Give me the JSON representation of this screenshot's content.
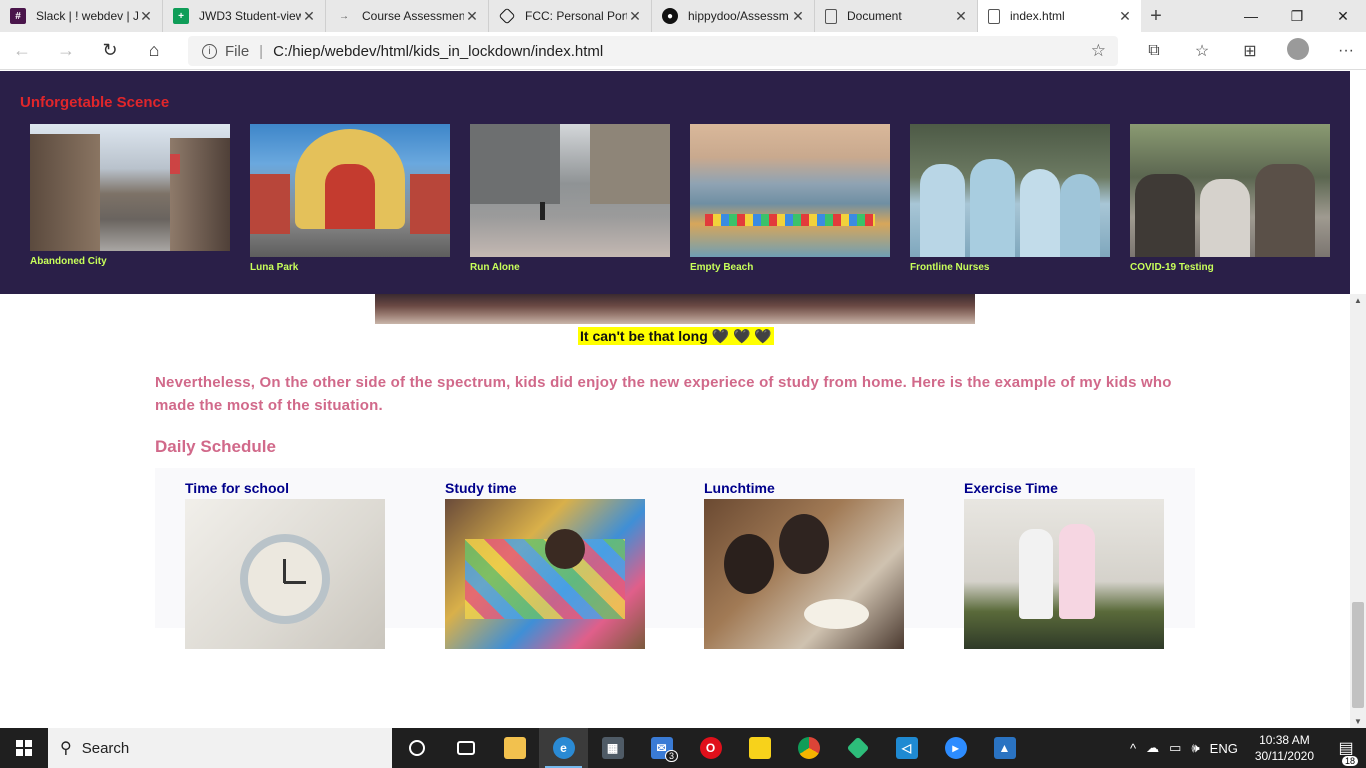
{
  "browser": {
    "tabs": [
      {
        "title": "Slack | ! webdev | J",
        "icon": "slack-icon",
        "color": "#4a154b"
      },
      {
        "title": "JWD3 Student-view",
        "icon": "sheets-icon",
        "color": "#0f9d58"
      },
      {
        "title": "Course Assessmen",
        "icon": "arrow-icon",
        "color": "#555555"
      },
      {
        "title": "FCC: Personal Port",
        "icon": "codepen-icon",
        "color": "#111111"
      },
      {
        "title": "hippydoo/Assessm",
        "icon": "github-icon",
        "color": "#111111"
      },
      {
        "title": "Document",
        "icon": "document-icon",
        "color": "#777777"
      },
      {
        "title": "index.html",
        "icon": "document-icon",
        "color": "#777777"
      }
    ],
    "address": {
      "file_label": "File",
      "url": "C:/hiep/webdev/html/kids_in_lockdown/index.html"
    }
  },
  "gallery": {
    "title": "Unforgetable Scence",
    "items": [
      {
        "caption": "Abandoned City"
      },
      {
        "caption": "Luna Park"
      },
      {
        "caption": "Run Alone"
      },
      {
        "caption": "Empty Beach"
      },
      {
        "caption": "Frontline Nurses"
      },
      {
        "caption": "COVID-19 Testing"
      }
    ]
  },
  "hero": {
    "caption": "It can't be that long 🖤 🖤 🖤"
  },
  "content": {
    "paragraph": "Nevertheless, On the other side of the spectrum, kids did enjoy the new experiece of study from home. Here is the example of my kids who made the most of the situation.",
    "schedule_title": "Daily Schedule",
    "schedule": [
      {
        "label": "Time for school"
      },
      {
        "label": "Study time"
      },
      {
        "label": "Lunchtime"
      },
      {
        "label": "Exercise Time"
      }
    ]
  },
  "taskbar": {
    "search_placeholder": "Search",
    "mail_badge": "3",
    "language": "ENG",
    "time": "10:38 AM",
    "date": "30/11/2020",
    "notification_count": "18"
  },
  "colors": {
    "header_bg": "#2a1f48",
    "gallery_title": "#e0262b",
    "caption": "#c8ff5a",
    "paragraph": "#d1698a",
    "schedule_label": "#00008b",
    "highlight": "#ffff00"
  }
}
